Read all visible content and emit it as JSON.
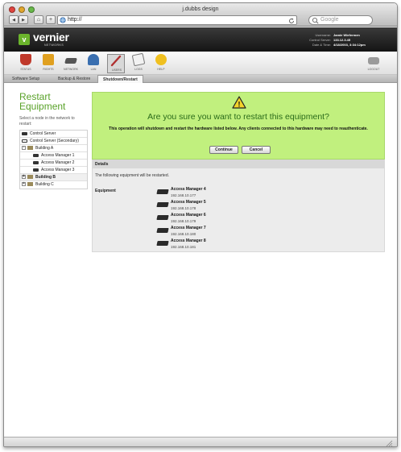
{
  "browser": {
    "title": "j.dubbs design",
    "back_glyph": "◀",
    "forward_glyph": "▶",
    "home_glyph": "⌂",
    "add_glyph": "+",
    "address": "http://",
    "search_placeholder": "Google"
  },
  "app": {
    "brand": "vernier",
    "brand_mark": "v",
    "brand_sub": "NETWORKS",
    "meta": {
      "username_label": "Username:",
      "username": "Jamie Wiefermen",
      "server_label": "Control Server:",
      "server": "133.12.3.45",
      "datetime_label": "Date & Time:",
      "datetime": "4/18/2003, 3:34:12pm"
    },
    "toolbar": [
      {
        "label": "STATUS",
        "icon": "status-icon",
        "color": "#c0392b"
      },
      {
        "label": "RIGHTS",
        "icon": "rights-icon",
        "color": "#e0a020"
      },
      {
        "label": "NETWORK",
        "icon": "network-icon",
        "color": "#555555"
      },
      {
        "label": "LAN",
        "icon": "lan-icon",
        "color": "#3a6fb0"
      },
      {
        "label": "USERS",
        "icon": "users-icon",
        "color": "#b03030"
      },
      {
        "label": "LOGS",
        "icon": "logs-icon",
        "color": "#eeeeee"
      },
      {
        "label": "HELP",
        "icon": "help-icon",
        "color": "#f0c020"
      }
    ],
    "logout_label": "LOGOUT",
    "tabs": [
      "Software Setup",
      "Backup & Restore",
      "Shutdown/Restart"
    ]
  },
  "sidebar": {
    "title": "Restart Equipment",
    "help": "Select a node in the network to restart:",
    "tree": [
      {
        "label": "Control Server",
        "kind": "server"
      },
      {
        "label": "Control Server (Secondary)",
        "kind": "server-secondary"
      },
      {
        "label": "Building A",
        "kind": "building",
        "toggle": "-"
      },
      {
        "label": "Access Manager 1",
        "kind": "device"
      },
      {
        "label": "Access Manager 2",
        "kind": "device"
      },
      {
        "label": "Access Manager 3",
        "kind": "device"
      },
      {
        "label": "Building B",
        "kind": "building",
        "toggle": "+"
      },
      {
        "label": "Building C",
        "kind": "building",
        "toggle": "+"
      }
    ]
  },
  "confirm": {
    "warning_glyph": "!",
    "question": "Are you sure you want to restart this equipment?",
    "message": "This operation will shutdown and restart the hardware listed below. Any clients connected to this hardware may need to reauthenticate.",
    "continue_label": "Continue",
    "cancel_label": "Cancel"
  },
  "details": {
    "heading": "Details",
    "intro": "The following equipment will be restarted.",
    "equipment_label": "Equipment",
    "equipment": [
      {
        "name": "Access Manager 4",
        "ip": "192.168.10.177"
      },
      {
        "name": "Access Manager 5",
        "ip": "192.168.10.178"
      },
      {
        "name": "Access Manager 6",
        "ip": "192.168.10.179"
      },
      {
        "name": "Access Manager 7",
        "ip": "192.168.10.180"
      },
      {
        "name": "Access Manager 8",
        "ip": "192.168.10.181"
      }
    ]
  },
  "colors": {
    "accent_green": "#5aa22a",
    "confirm_bg": "#c1f07e",
    "question_text": "#2a6b1a"
  }
}
